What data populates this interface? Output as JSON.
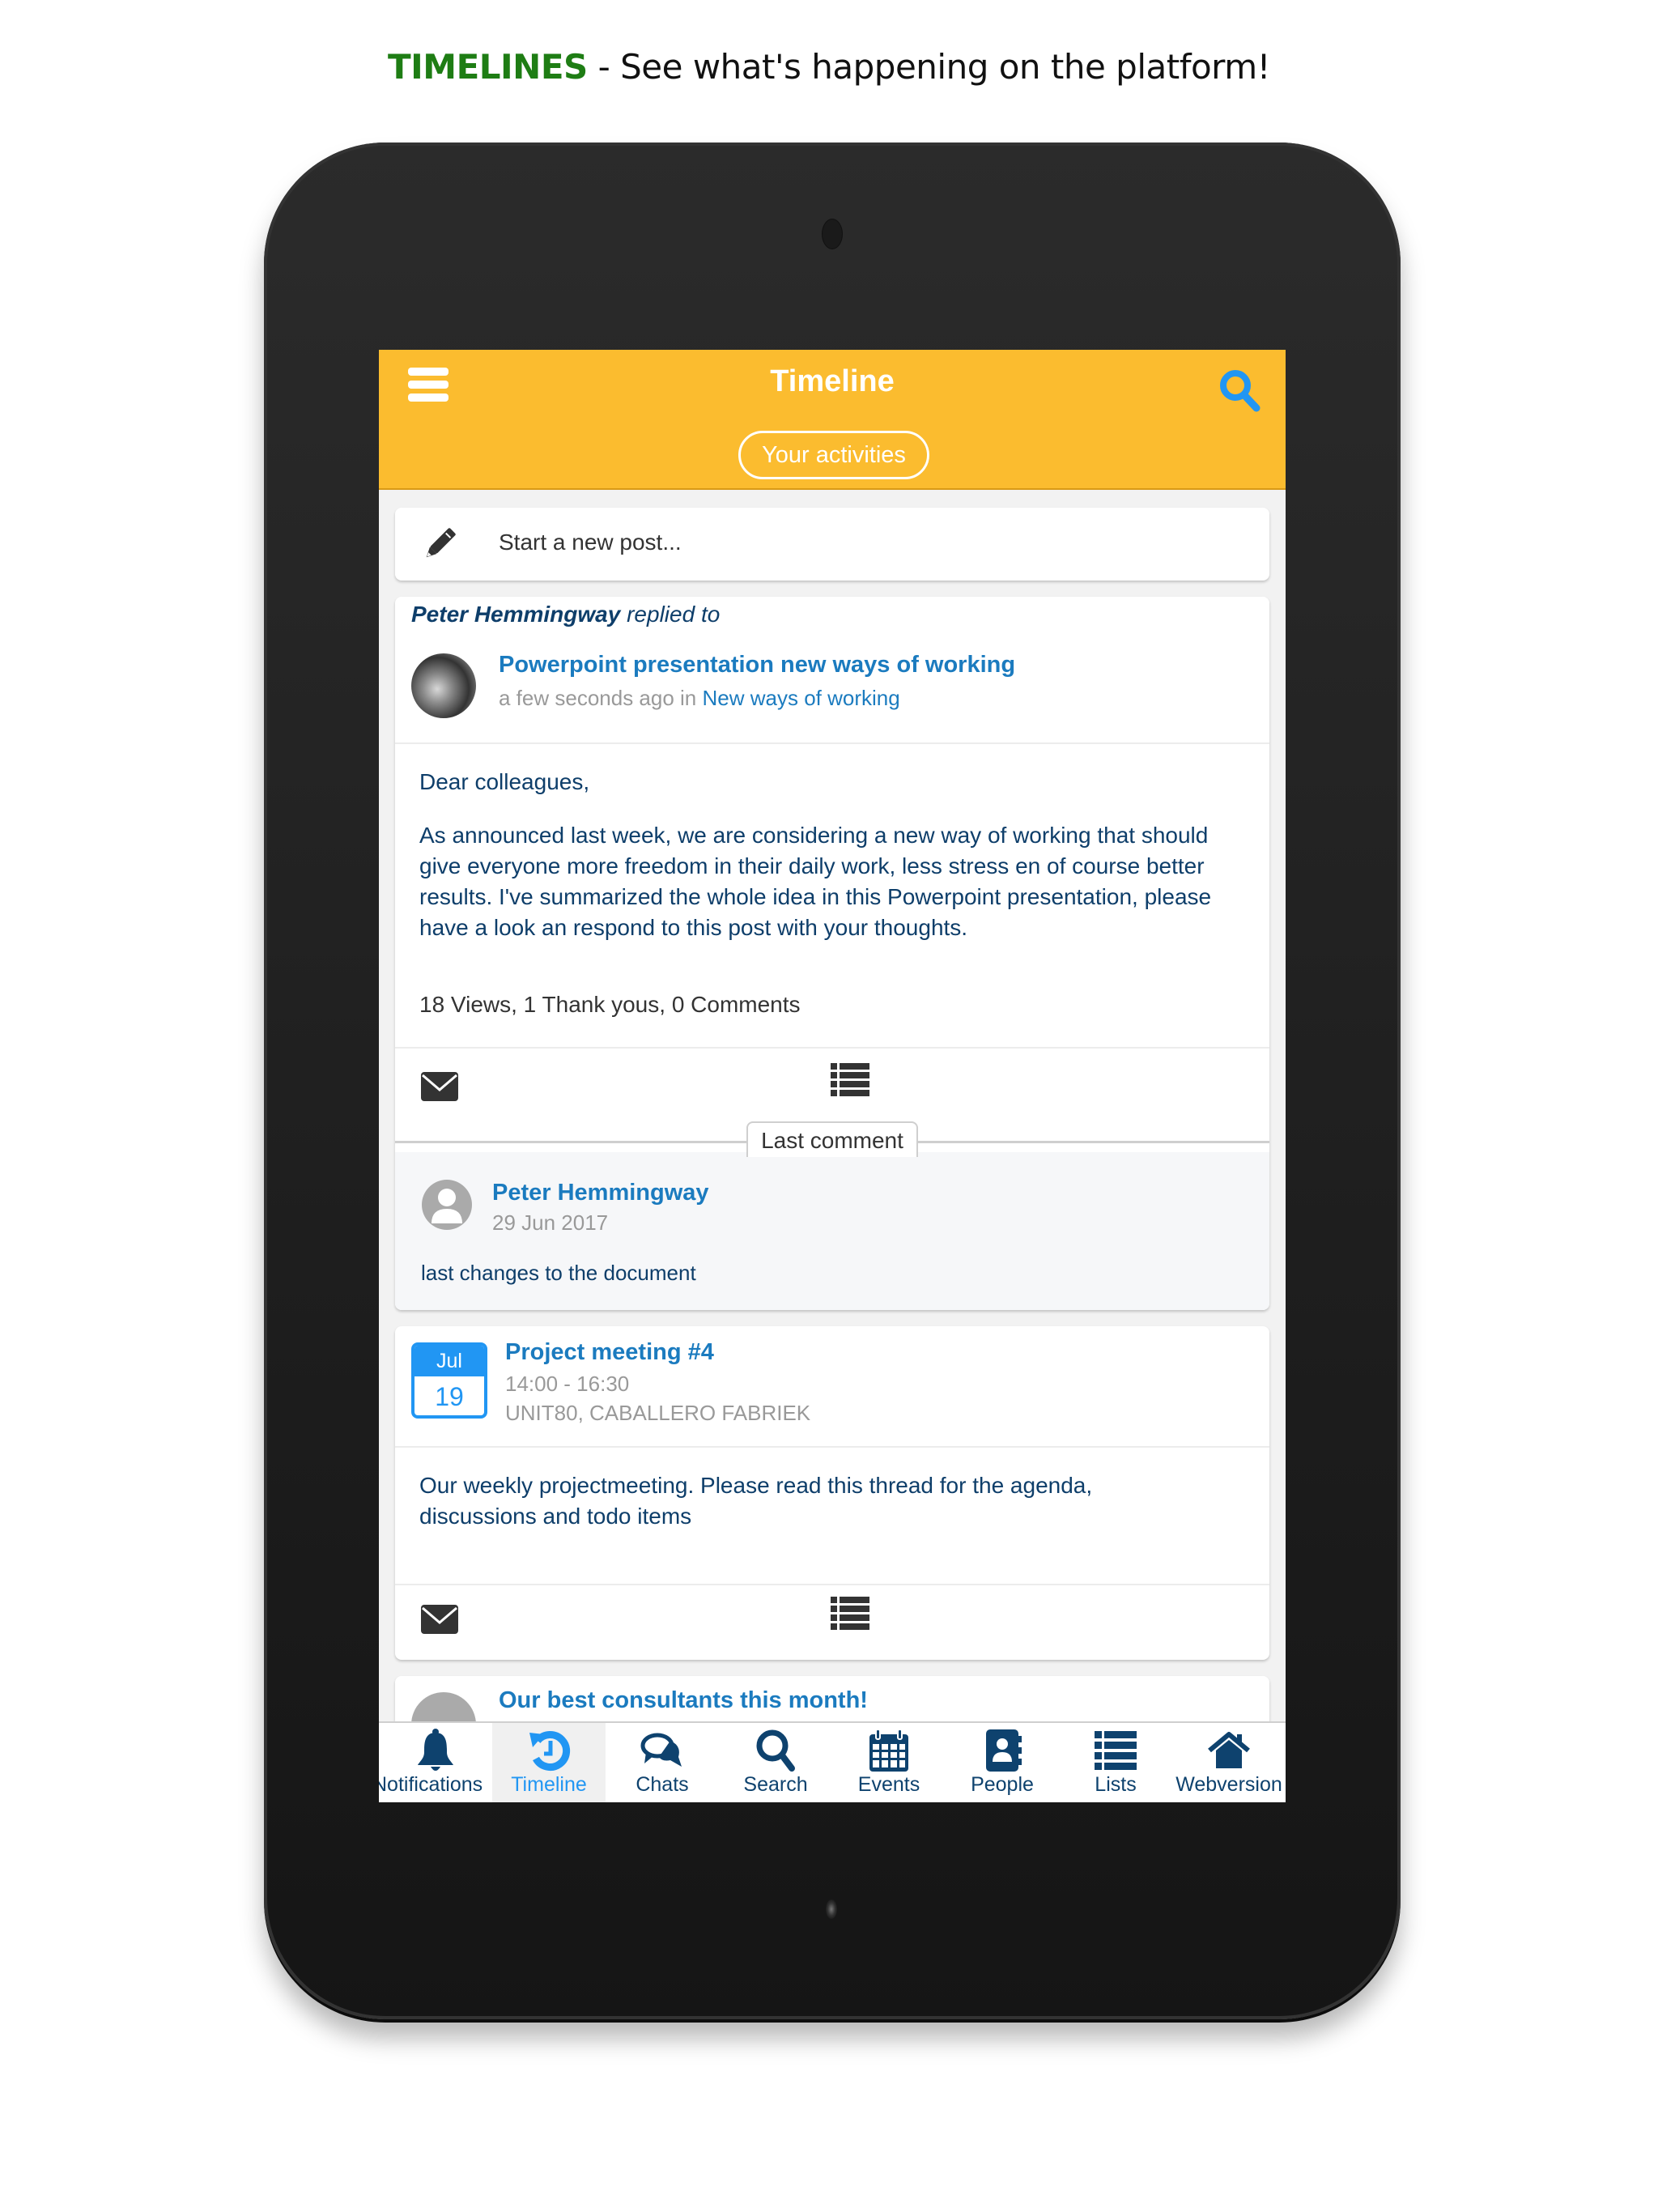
{
  "promo": {
    "highlight": "TIMELINES",
    "text": " - See what's happening on the platform!"
  },
  "header": {
    "title": "Timeline",
    "filter_button": "Your activities",
    "menu_icon": "hamburger-menu-icon",
    "search_icon": "search-icon"
  },
  "new_post": {
    "icon": "pencil-icon",
    "label": "Start a new post..."
  },
  "post": {
    "actor": "Peter Hemmingway",
    "action": " replied to",
    "title": "Powerpoint presentation new ways of working",
    "time": "a few seconds ago in ",
    "group": "New ways of working",
    "greeting": "Dear colleagues,",
    "body": "As announced last week, we are considering a new way of working that should give everyone more freedom in their daily work, less stress en of course better results. I've summarized the whole idea in this Powerpoint presentation, please have a look an respond to this post with your thoughts.",
    "stats": "18 Views, 1 Thank yous, 0 Comments",
    "last_comment_label": "Last comment",
    "comment": {
      "author": "Peter Hemmingway",
      "date": "29 Jun 2017",
      "text": "last changes to the document"
    }
  },
  "event": {
    "month": "Jul",
    "day": "19",
    "title": "Project meeting #4",
    "time": "14:00 - 16:30",
    "location": "UNIT80, CABALLERO FABRIEK",
    "body": "Our weekly projectmeeting. Please read this thread for the agenda, discussions and todo items"
  },
  "peek": {
    "title": "Our best consultants this month!"
  },
  "nav": {
    "items": [
      {
        "label": "Notifications",
        "icon": "bell-icon"
      },
      {
        "label": "Timeline",
        "icon": "history-icon",
        "active": true
      },
      {
        "label": "Chats",
        "icon": "chat-bubbles-icon"
      },
      {
        "label": "Search",
        "icon": "search-icon"
      },
      {
        "label": "Events",
        "icon": "calendar-icon"
      },
      {
        "label": "People",
        "icon": "address-book-icon"
      },
      {
        "label": "Lists",
        "icon": "list-icon"
      },
      {
        "label": "Webversion",
        "icon": "home-icon"
      }
    ]
  },
  "colors": {
    "header": "#fbbc2f",
    "accent_blue": "#2196f3",
    "link_blue": "#1b7bbf",
    "text_navy": "#0e3e6a",
    "promo_green": "#1e7d14"
  }
}
